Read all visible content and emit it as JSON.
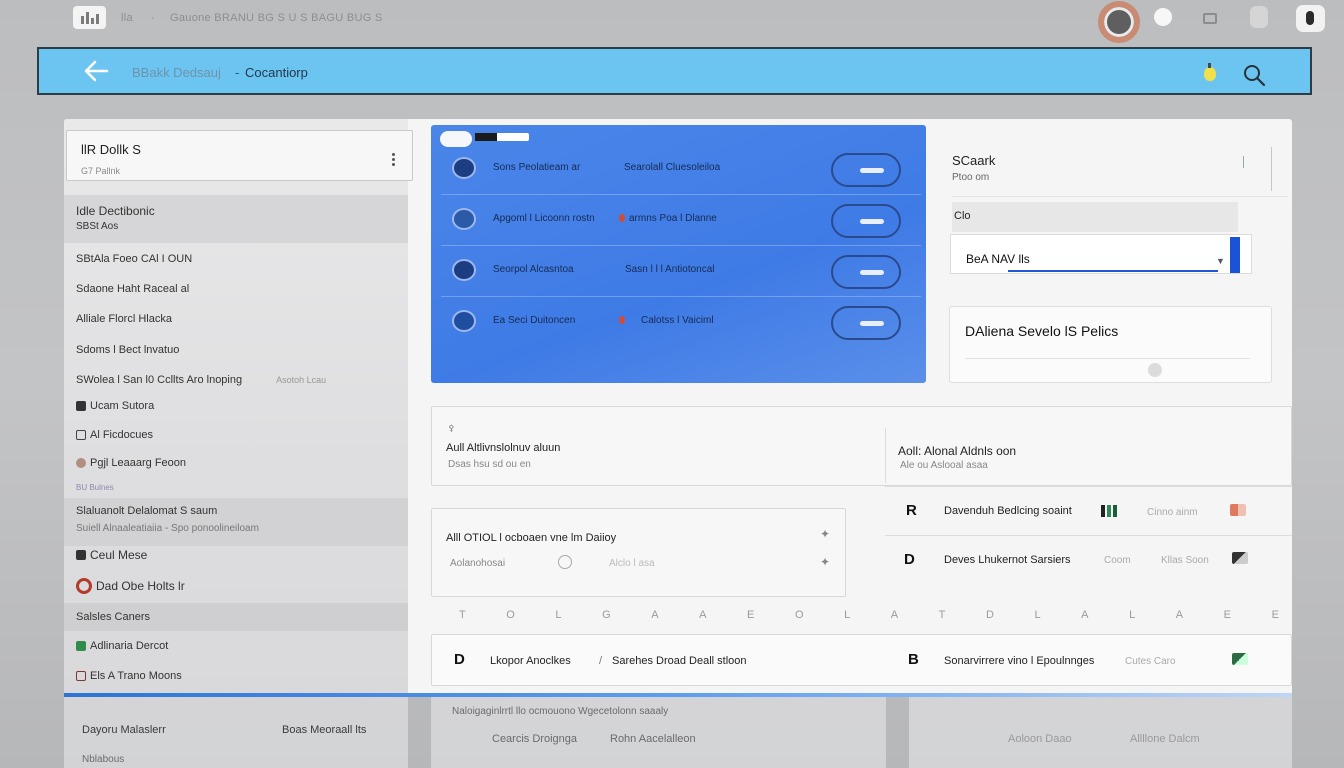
{
  "os_bar": {
    "text1": "lla",
    "text2": "·",
    "text3": "Gauone  BRANU BG S U S  BAGU BUG S",
    "icons": [
      "app-logo-icon",
      "user-ring-icon",
      "status-dot-icon",
      "grid-icon",
      "pill-icon",
      "badge-icon"
    ]
  },
  "header": {
    "crumb_parent": "BBakk Dedsauj",
    "crumb_sep": "-",
    "crumb_current": "Cocantiorp"
  },
  "left_panel": {
    "search_title": "llR Dollk S",
    "search_sub": "G7 Pallnk",
    "items": [
      {
        "label": "Idle Dectibonic",
        "sub": ""
      },
      {
        "label": "SBSt  Aos",
        "sub": ""
      },
      {
        "label": "SBtAla  Foeo  CAl  I OUN",
        "sub": ""
      },
      {
        "label": "Sdaone  Haht  Raceal al",
        "sub": ""
      },
      {
        "label": "Alliale  Florcl Hlacka",
        "sub": ""
      },
      {
        "label": "Sdoms  l  Bect lnvatuo",
        "sub": ""
      },
      {
        "label": "SWolea  l  San  l0  Ccllts  Aro  lnoping",
        "sub": "Asotoh Lcau"
      },
      {
        "label": "Ucam  Sutora",
        "sub": ""
      },
      {
        "label": "Al  Ficdocues",
        "sub": ""
      },
      {
        "label": "Pgjl  Leaaarg  Feoon",
        "sub": ""
      },
      {
        "label": "BU  Bulnes",
        "sub": ""
      },
      {
        "label": "Slaluanolt  Delalomat  S  saum",
        "sub": ""
      },
      {
        "label": "Suiell  Alnaaleatiaiia  -  Spo  ponoolineiloam",
        "sub": ""
      },
      {
        "label": "Ceul  Mese",
        "sub": ""
      },
      {
        "label": "Dad  Obe  Holts  lr",
        "sub": ""
      },
      {
        "label": "Salsles  Caners",
        "sub": ""
      },
      {
        "label": "Adlinaria  Dercot",
        "sub": ""
      },
      {
        "label": "Els  A  Trano  Moons",
        "sub": ""
      }
    ]
  },
  "blue_card": {
    "rows": [
      {
        "name": "Sons Peolatieam ar",
        "desc": "Searolall Cluesoleiloa"
      },
      {
        "name": "Apgoml l  Licoonn  rostn",
        "desc": "armns  Poa  l  Dlanne"
      },
      {
        "name": "Seorpol  Alcasntoa",
        "desc": "Sasn  l l l  Antiotoncal"
      },
      {
        "name": "Ea Seci  Duitoncen",
        "desc": "Calotss  l  Vaiciml"
      }
    ]
  },
  "settings": {
    "title": "SCaark",
    "subtitle": "Ptoo om",
    "section": "Clo",
    "select_value": "BeA  NAV lls",
    "card_title": "DAliena  Sevelo  lS  Pelics"
  },
  "lower": {
    "box1_label": "Aull  Altlivnslolnuv  aluun",
    "box1_sub": "Dsas  hsu  sd  ou  en",
    "box2_label": "Aoll:  Alonal  Aldnls  oon",
    "box2_sub": "Ale  ou  Aslooal  asaa",
    "box3_label": "Alll  OTIOL  l  ocboaen  vne  lm  Daiioy",
    "box3_sub": "Aolanohosai",
    "box3_faint": "Alclo  l  asa",
    "row1_letter": "R",
    "row1_text": "Davenduh  Bedlcing  soaint",
    "row1_faint": "Cinno  ainm",
    "row2_letter": "D",
    "row2_text": "Deves  Lhukernot  Sarsiers",
    "row2_faint1": "Coom",
    "row2_faint2": "Kllas  Soon",
    "spaced_letters": [
      "T",
      "O",
      "L",
      "G",
      "A",
      "A",
      "E",
      "O",
      "L",
      "A",
      "T",
      "D",
      "L",
      "A",
      "L",
      "A",
      "E",
      "E"
    ],
    "row3_letter": "D",
    "row3_text": "Lkopor  Anoclkes",
    "row3_sep": "/",
    "row3_text2": "Sarehes  Droad  Deall  stloon",
    "row4_letter": "B",
    "row4_text": "Sonarvirrere  vino  l  Epoulnnges",
    "row4_faint": "Cutes  Caro"
  },
  "ghost_rows": {
    "left1": "Dayoru  Malaslerr",
    "left1b": "Boas  Meoraall lts",
    "left2": "Nblabous",
    "mid1": "Naloigaginlrrtl  llo  ocmouono  Wgecetolonn  saaaly",
    "mid2": "Cearcis  Droignga",
    "mid2b": "Rohn  Aacelalleon",
    "right1": "Aoloon  Daao",
    "right1b": "Allllone  Dalcm"
  },
  "colors": {
    "header_bg": "#6cc5f1",
    "card_blue": "#4a86e8",
    "accent_blue": "#1e58d4"
  }
}
